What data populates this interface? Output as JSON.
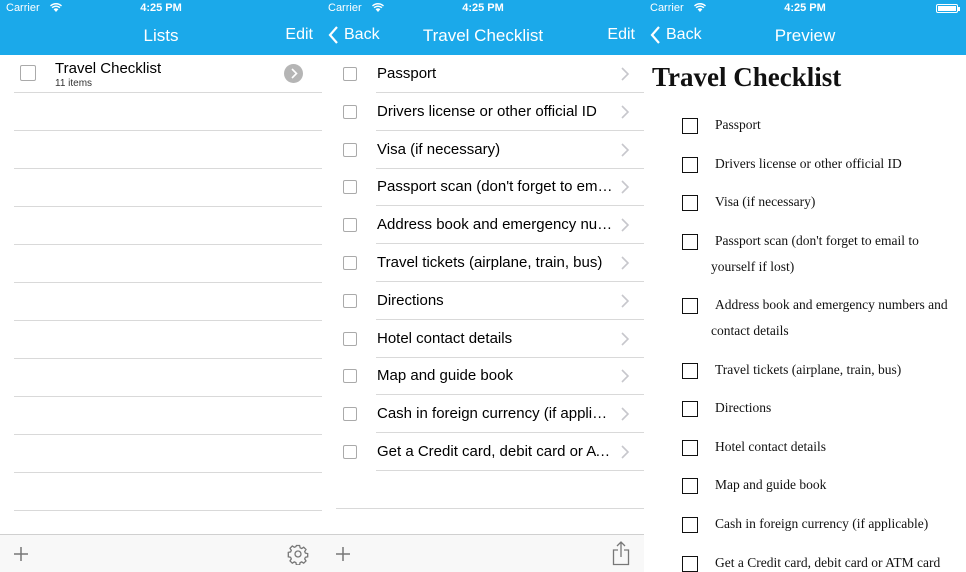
{
  "status": {
    "carrier": "Carrier",
    "time": "4:25 PM"
  },
  "colors": {
    "accent": "#1ba9ea",
    "separator": "#d9d9d9",
    "toolbar": "#f8f8f8"
  },
  "lists_screen": {
    "title": "Lists",
    "edit_label": "Edit",
    "lists": [
      {
        "name": "Travel Checklist",
        "count": "11 items"
      }
    ],
    "toolbar": {
      "add_icon": "plus-icon",
      "settings_icon": "gear-icon"
    }
  },
  "checklist_screen": {
    "title": "Travel Checklist",
    "back_label": "Back",
    "edit_label": "Edit",
    "items": [
      "Passport",
      "Drivers license or other official ID",
      "Visa (if necessary)",
      "Passport scan (don't forget to email to yourself if lost)",
      "Address book and emergency numbers and contact details",
      "Travel tickets (airplane, train, bus)",
      "Directions",
      "Hotel contact details",
      "Map and guide book",
      "Cash in foreign currency (if applicable)",
      "Get a Credit card, debit card or ATM card"
    ],
    "toolbar": {
      "add_icon": "plus-icon",
      "share_icon": "share-icon"
    }
  },
  "preview_screen": {
    "title": "Preview",
    "back_label": "Back",
    "heading": "Travel Checklist",
    "items": [
      {
        "line1": "Passport"
      },
      {
        "line1": "Drivers license or other official ID"
      },
      {
        "line1": "Visa (if necessary)"
      },
      {
        "line1": "Passport scan (don't forget to email to",
        "line2": "yourself if lost)"
      },
      {
        "line1": "Address book and emergency numbers and",
        "line2": "contact details"
      },
      {
        "line1": "Travel tickets (airplane, train, bus)"
      },
      {
        "line1": "Directions"
      },
      {
        "line1": "Hotel contact details"
      },
      {
        "line1": "Map and guide book"
      },
      {
        "line1": "Cash in foreign currency (if applicable)"
      },
      {
        "line1": "Get a Credit card, debit card or ATM card"
      }
    ]
  }
}
